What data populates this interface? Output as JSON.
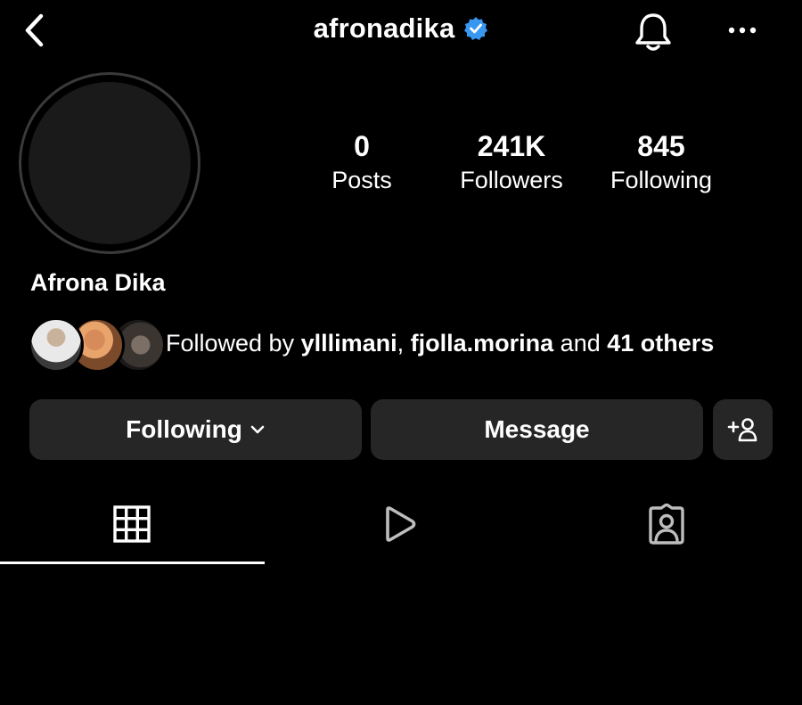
{
  "header": {
    "username": "afronadika",
    "verified_color": "#3897f0"
  },
  "profile": {
    "display_name": "Afrona Dika",
    "stats": [
      {
        "value": "0",
        "label": "Posts"
      },
      {
        "value": "241K",
        "label": "Followers"
      },
      {
        "value": "845",
        "label": "Following"
      }
    ]
  },
  "followed_by": {
    "prefix": "Followed by ",
    "user1": "ylllimani",
    "separator": ", ",
    "user2": "fjolla.morina",
    "middle": " and ",
    "others": "41 others"
  },
  "actions": {
    "following_label": "Following",
    "message_label": "Message"
  },
  "icons": {
    "back": "chevron-left-icon",
    "verified": "verified-badge-icon",
    "bell": "bell-icon",
    "more": "more-horizontal-icon",
    "chevron": "chevron-down-icon",
    "add_user": "add-user-icon",
    "grid": "grid-icon",
    "reels": "play-icon",
    "tagged": "tagged-person-icon"
  },
  "tabs": {
    "active": "grid"
  },
  "colors": {
    "background": "#000000",
    "button_bg": "#262626",
    "accent_verified": "#3897f0"
  }
}
